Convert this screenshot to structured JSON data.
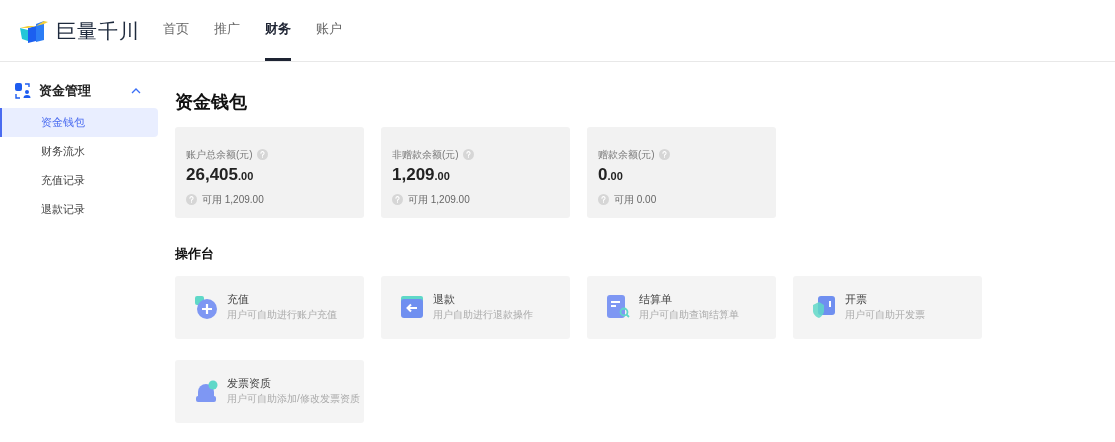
{
  "header": {
    "logo": "巨量千川",
    "nav": [
      {
        "label": "首页",
        "selected": false
      },
      {
        "label": "推广",
        "selected": false
      },
      {
        "label": "财务",
        "selected": true
      },
      {
        "label": "账户",
        "selected": false
      }
    ]
  },
  "sidebar": {
    "group": {
      "label": "资金管理",
      "expanded": true
    },
    "items": [
      {
        "label": "资金钱包",
        "selected": true
      },
      {
        "label": "财务流水",
        "selected": false
      },
      {
        "label": "充值记录",
        "selected": false
      },
      {
        "label": "退款记录",
        "selected": false
      }
    ]
  },
  "page_title": "资金钱包",
  "balances": [
    {
      "label": "账户总余额(元)",
      "integer": "26,405",
      "decimal": ".00",
      "available": "可用 1,209.00"
    },
    {
      "label": "非赠款余额(元)",
      "integer": "1,209",
      "decimal": ".00",
      "available": "可用 1,209.00"
    },
    {
      "label": "赠款余额(元)",
      "integer": "0",
      "decimal": ".00",
      "available": "可用 0.00"
    }
  ],
  "console_title": "操作台",
  "actions": [
    {
      "kind": "recharge",
      "title": "充值",
      "description": "用户可自助进行账户充值"
    },
    {
      "kind": "refund",
      "title": "退款",
      "description": "用户自助进行退款操作"
    },
    {
      "kind": "statement",
      "title": "结算单",
      "description": "用户可自助查询结算单"
    },
    {
      "kind": "invoice",
      "title": "开票",
      "description": "用户可自助开发票"
    },
    {
      "kind": "qualification",
      "title": "发票资质",
      "description": "用户可自助添加/修改发票资质"
    }
  ]
}
